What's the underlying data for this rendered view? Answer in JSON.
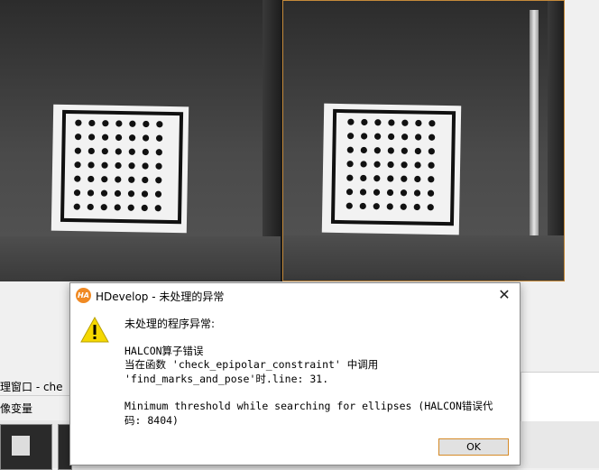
{
  "dialog": {
    "title": "HDevelop - 未处理的异常",
    "app_icon_text": "HA",
    "close_label": "✕",
    "heading": "未处理的程序异常:",
    "error_lines": [
      "HALCON算子错误",
      "当在函数 'check_epipolar_constraint' 中调用",
      "'find_marks_and_pose'时.line: 31."
    ],
    "detail_lines": [
      "Minimum threshold while searching for ellipses (HALCON错误代",
      "码: 8404)"
    ],
    "ok_label": "OK"
  },
  "background": {
    "window_title": "理窗口 - che",
    "tab_label": "像变量"
  },
  "colors": {
    "accent": "#f08a24",
    "warning": "#f5d800"
  },
  "icons": {
    "app": "halcon-app-icon",
    "close": "close-icon",
    "warning": "warning-icon"
  }
}
